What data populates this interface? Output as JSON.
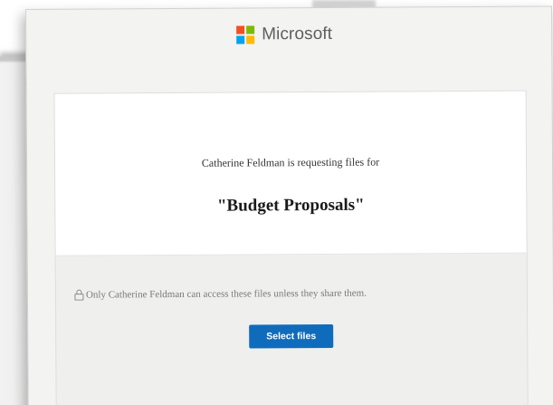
{
  "brand": {
    "name": "Microsoft",
    "logo_colors": [
      "#f25022",
      "#7fba00",
      "#00a4ef",
      "#ffb900"
    ]
  },
  "request": {
    "requester_line": "Catherine Feldman is requesting files for",
    "folder_name": "\"Budget Proposals\""
  },
  "access": {
    "note": "Only Catherine Feldman can access these files unless they share them.",
    "icon": "lock-icon"
  },
  "actions": {
    "select_files_label": "Select files",
    "button_color": "#0f6cbd"
  }
}
